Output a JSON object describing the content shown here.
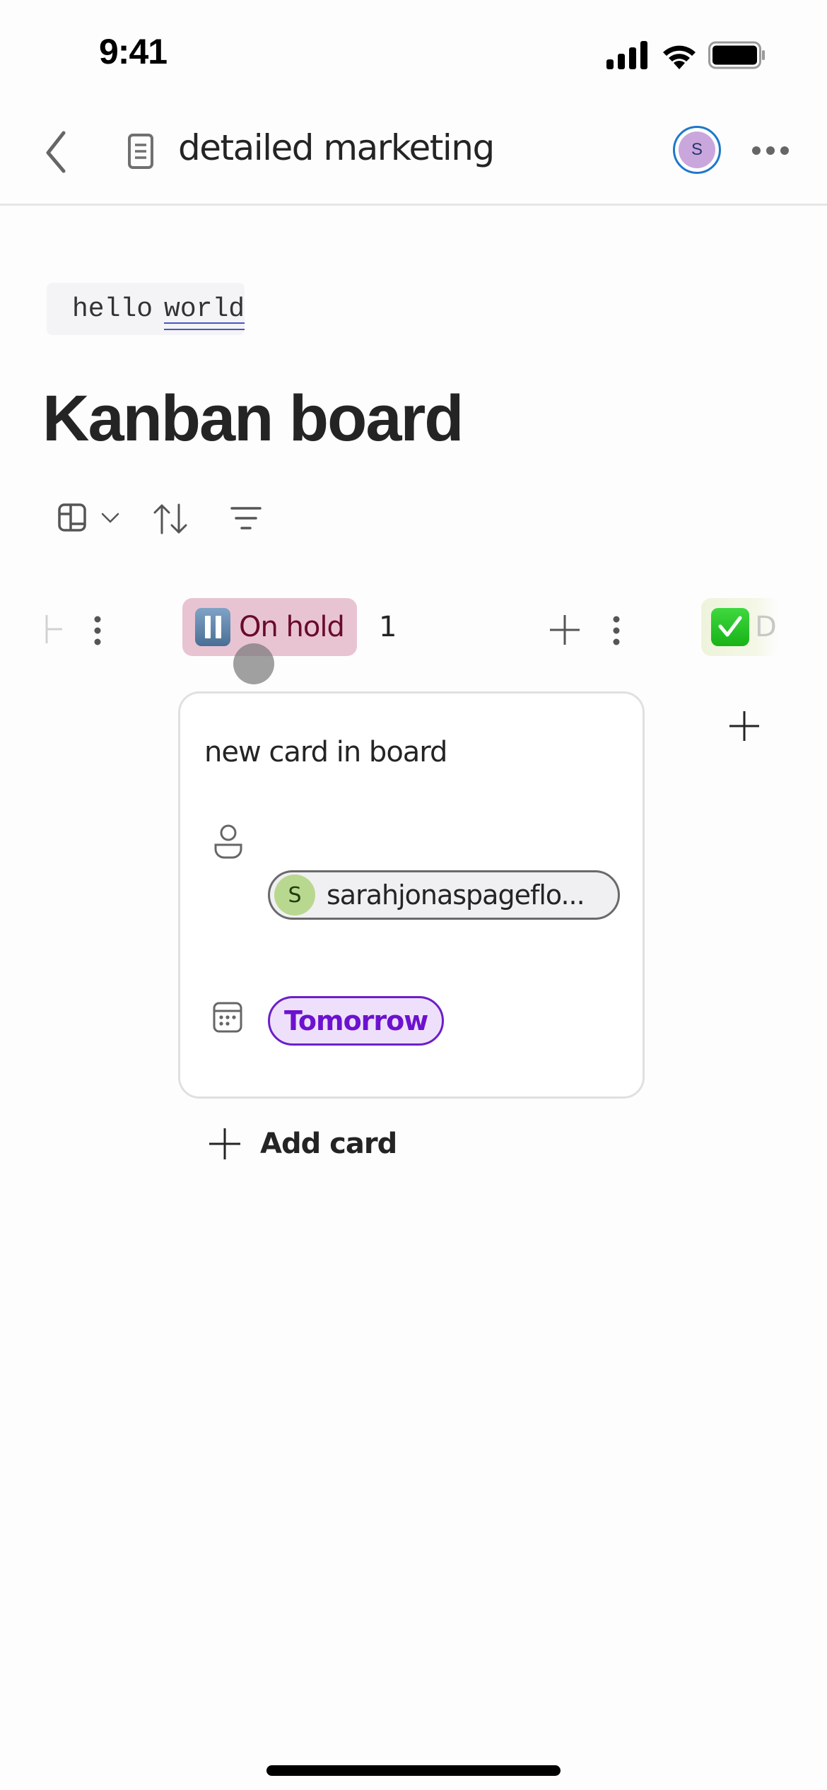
{
  "status_bar": {
    "time": "9:41",
    "icons": [
      "cellular-signal-icon",
      "wifi-icon",
      "battery-icon"
    ]
  },
  "navbar": {
    "back_icon": "chevron-left-icon",
    "doc_icon": "document-icon",
    "title": "detailed marketing",
    "avatar_initial": "S",
    "more_icon": "more-horizontal-icon"
  },
  "content": {
    "code_snippet": {
      "word1": "hello",
      "word2": "world"
    },
    "page_title": "Kanban board",
    "toolbar": {
      "items": [
        "board-layout-icon",
        "chevron-down-icon",
        "sort-icon",
        "filter-icon"
      ]
    }
  },
  "board": {
    "columns": [
      {
        "label": "On hold",
        "emoji": "pause-button-icon",
        "count": "1",
        "color_bg": "#e8c4d2",
        "color_text": "#6a0a2a",
        "cards": [
          {
            "title": "new card in board",
            "assignee": {
              "initial": "S",
              "name": "sarahjonaspageflo..."
            },
            "due": "Tomorrow"
          }
        ],
        "add_card_label": "Add card"
      },
      {
        "label": "D",
        "emoji": "check-mark-button-icon",
        "color_bg": "#eef3dc"
      }
    ]
  },
  "colors": {
    "accent_blue": "#1e78c8",
    "date_pill_purple": "#6c12cf",
    "underline_blue": "#4a55c8"
  }
}
